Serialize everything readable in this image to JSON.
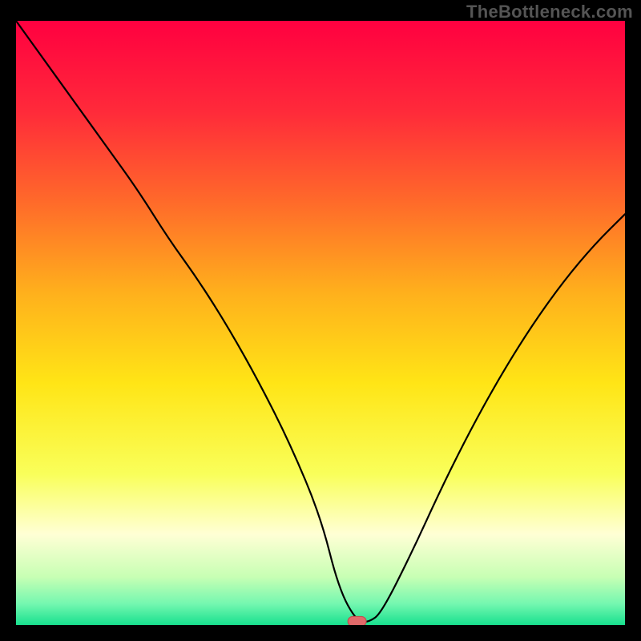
{
  "watermark": "TheBottleneck.com",
  "chart_data": {
    "type": "line",
    "title": "",
    "xlabel": "",
    "ylabel": "",
    "xlim": [
      0,
      100
    ],
    "ylim": [
      0,
      100
    ],
    "grid": false,
    "legend": false,
    "background": {
      "kind": "vertical-gradient",
      "stops": [
        {
          "pos": 0.0,
          "color": "#ff0040"
        },
        {
          "pos": 0.15,
          "color": "#ff2a3a"
        },
        {
          "pos": 0.3,
          "color": "#ff6a2a"
        },
        {
          "pos": 0.45,
          "color": "#ffb01c"
        },
        {
          "pos": 0.6,
          "color": "#ffe516"
        },
        {
          "pos": 0.75,
          "color": "#f9ff5a"
        },
        {
          "pos": 0.85,
          "color": "#ffffd5"
        },
        {
          "pos": 0.92,
          "color": "#c8ffb4"
        },
        {
          "pos": 0.965,
          "color": "#74f7b0"
        },
        {
          "pos": 1.0,
          "color": "#18e08e"
        }
      ]
    },
    "curve": {
      "color": "#000000",
      "width": 2.2,
      "x": [
        0,
        5,
        10,
        15,
        20,
        25,
        30,
        35,
        40,
        45,
        50,
        53,
        56,
        58,
        60,
        65,
        70,
        75,
        80,
        85,
        90,
        95,
        100
      ],
      "y": [
        100,
        93,
        86,
        79,
        72,
        64,
        57,
        49,
        40,
        30,
        18,
        6,
        0.5,
        0.5,
        2,
        12,
        23,
        33,
        42,
        50,
        57,
        63,
        68
      ]
    },
    "marker": {
      "x": 56,
      "y": 0.6,
      "shape": "rounded-rect",
      "fill": "#e06a6a",
      "stroke": "#c24f4f",
      "width_units": 3.0,
      "height_units": 1.6
    }
  }
}
